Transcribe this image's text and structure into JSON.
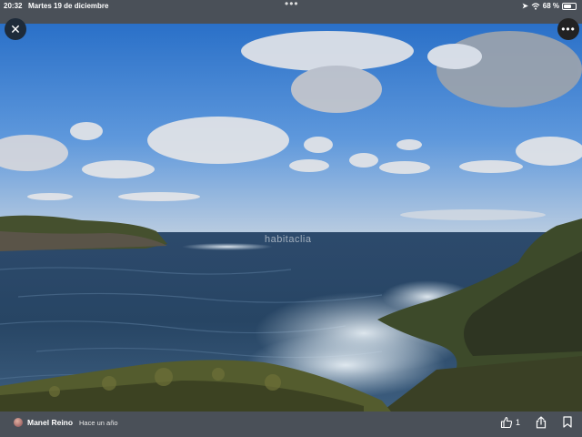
{
  "status": {
    "time": "20:32",
    "date": "Martes 19 de diciembre",
    "battery": "68 %"
  },
  "photo": {
    "watermark": "habitaclia"
  },
  "controls": {
    "close_icon": "close-icon",
    "more_icon": "more-icon"
  },
  "footer": {
    "author": "Manel Reino",
    "time_ago": "Hace un año",
    "likes": "1"
  }
}
